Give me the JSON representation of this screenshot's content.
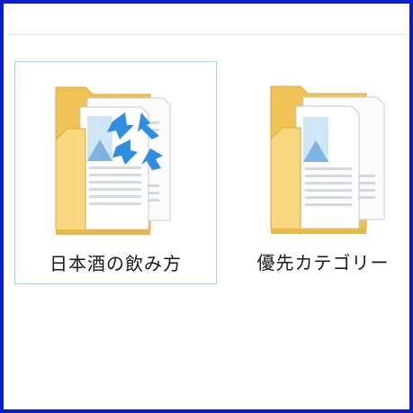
{
  "folders": [
    {
      "name": "日本酒の飲み方",
      "selected": true,
      "icon": "folder-with-documents-icon",
      "shortcut_overlay": true
    },
    {
      "name": "優先カテゴリー",
      "selected": false,
      "icon": "folder-with-documents-icon",
      "shortcut_overlay": false
    }
  ],
  "colors": {
    "window_border": "#0a1ec8",
    "selection_border": "#9fd0f3",
    "folder_back": "#f0c75c",
    "folder_front": "#f9dc8a",
    "arrow_blue": "#2e8fe0"
  }
}
